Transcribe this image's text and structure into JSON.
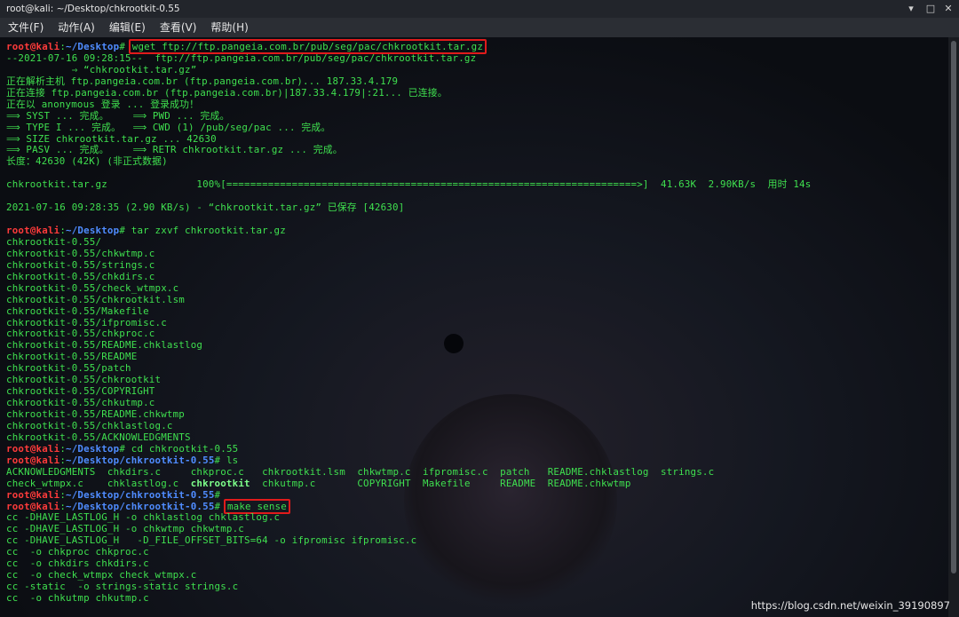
{
  "window": {
    "title": "root@kali: ~/Desktop/chkrootkit-0.55"
  },
  "menu": [
    "文件(F)",
    "动作(A)",
    "编辑(E)",
    "查看(V)",
    "帮助(H)"
  ],
  "terminal": {
    "user": "root",
    "at": "@",
    "host": "kali",
    "colon": ":",
    "path_desktop": "~/Desktop",
    "path_chk": "~/Desktop/chkrootkit-0.55",
    "hash": "#",
    "cmd_wget": "wget ftp://ftp.pangeia.com.br/pub/seg/pac/chkrootkit.tar.gz",
    "wget_out": [
      "--2021-07-16 09:28:15--  ftp://ftp.pangeia.com.br/pub/seg/pac/chkrootkit.tar.gz",
      "           ⇒ “chkrootkit.tar.gz”",
      "正在解析主机 ftp.pangeia.com.br (ftp.pangeia.com.br)... 187.33.4.179",
      "正在连接 ftp.pangeia.com.br (ftp.pangeia.com.br)|187.33.4.179|:21... 已连接。",
      "正在以 anonymous 登录 ... 登录成功！",
      "⟹ SYST ... 完成。    ⟹ PWD ... 完成。",
      "⟹ TYPE I ... 完成。  ⟹ CWD (1) /pub/seg/pac ... 完成。",
      "⟹ SIZE chkrootkit.tar.gz ... 42630",
      "⟹ PASV ... 完成。    ⟹ RETR chkrootkit.tar.gz ... 完成。",
      "长度：42630 (42K) (非正式数据)",
      "",
      "chkrootkit.tar.gz               100%[=====================================================================>]  41.63K  2.90KB/s  用时 14s",
      "",
      "2021-07-16 09:28:35 (2.90 KB/s) - “chkrootkit.tar.gz” 已保存 [42630]",
      ""
    ],
    "cmd_tar": "tar zxvf chkrootkit.tar.gz",
    "tar_out": [
      "chkrootkit-0.55/",
      "chkrootkit-0.55/chkwtmp.c",
      "chkrootkit-0.55/strings.c",
      "chkrootkit-0.55/chkdirs.c",
      "chkrootkit-0.55/check_wtmpx.c",
      "chkrootkit-0.55/chkrootkit.lsm",
      "chkrootkit-0.55/Makefile",
      "chkrootkit-0.55/ifpromisc.c",
      "chkrootkit-0.55/chkproc.c",
      "chkrootkit-0.55/README.chklastlog",
      "chkrootkit-0.55/README",
      "chkrootkit-0.55/patch",
      "chkrootkit-0.55/chkrootkit",
      "chkrootkit-0.55/COPYRIGHT",
      "chkrootkit-0.55/chkutmp.c",
      "chkrootkit-0.55/README.chkwtmp",
      "chkrootkit-0.55/chklastlog.c",
      "chkrootkit-0.55/ACKNOWLEDGMENTS"
    ],
    "cmd_cd": "cd chkrootkit-0.55",
    "cmd_ls": "ls",
    "ls_row1": "ACKNOWLEDGMENTS  chkdirs.c     chkproc.c   chkrootkit.lsm  chkwtmp.c  ifpromisc.c  patch   README.chklastlog  strings.c",
    "ls_row2_a": "check_wtmpx.c    chklastlog.c  ",
    "ls_row2_exe": "chkrootkit",
    "ls_row2_b": "  chkutmp.c       COPYRIGHT  Makefile     README  README.chkwtmp",
    "cmd_make": "make sense",
    "make_out": [
      "cc -DHAVE_LASTLOG_H -o chklastlog chklastlog.c",
      "cc -DHAVE_LASTLOG_H -o chkwtmp chkwtmp.c",
      "cc -DHAVE_LASTLOG_H   -D_FILE_OFFSET_BITS=64 -o ifpromisc ifpromisc.c",
      "cc  -o chkproc chkproc.c",
      "cc  -o chkdirs chkdirs.c",
      "cc  -o check_wtmpx check_wtmpx.c",
      "cc -static  -o strings-static strings.c",
      "cc  -o chkutmp chkutmp.c"
    ]
  },
  "watermark": "https://blog.csdn.net/weixin_39190897",
  "colors": {
    "prompt_user": "#ff3b3b",
    "prompt_path": "#4f8cff",
    "output": "#3fe04f",
    "highlight_box": "#e01b1b"
  }
}
